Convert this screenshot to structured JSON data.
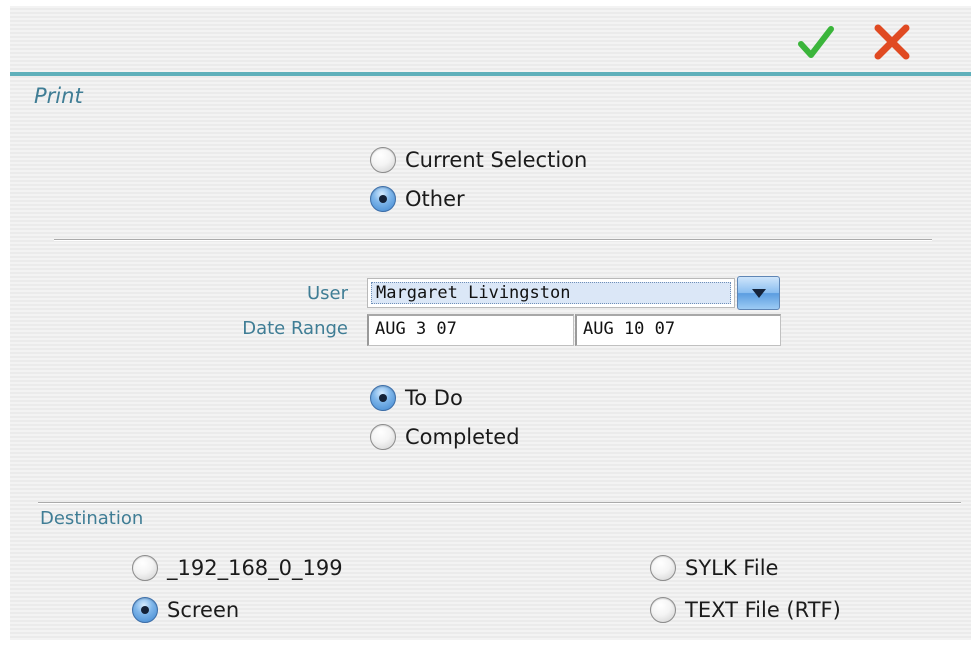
{
  "toolbar": {
    "ok_icon": "checkmark-icon",
    "ok_color": "#3bb53b",
    "cancel_icon": "close-icon",
    "cancel_color": "#e04a22",
    "accent": "#5fb0bb"
  },
  "print": {
    "title": "Print",
    "scope_options": [
      {
        "label": "Current Selection",
        "selected": false
      },
      {
        "label": "Other",
        "selected": true
      }
    ]
  },
  "filters": {
    "user_label": "User",
    "user_value": "Margaret Livingston",
    "date_range_label": "Date Range",
    "date_from": "AUG 3 07",
    "date_to": "AUG 10 07",
    "status_options": [
      {
        "label": "To Do",
        "selected": true
      },
      {
        "label": "Completed",
        "selected": false
      }
    ]
  },
  "destination": {
    "title": "Destination",
    "options": [
      {
        "label": "_192_168_0_199",
        "selected": false
      },
      {
        "label": "Screen",
        "selected": true
      },
      {
        "label": "SYLK File",
        "selected": false
      },
      {
        "label": "TEXT File (RTF)",
        "selected": false
      }
    ]
  }
}
